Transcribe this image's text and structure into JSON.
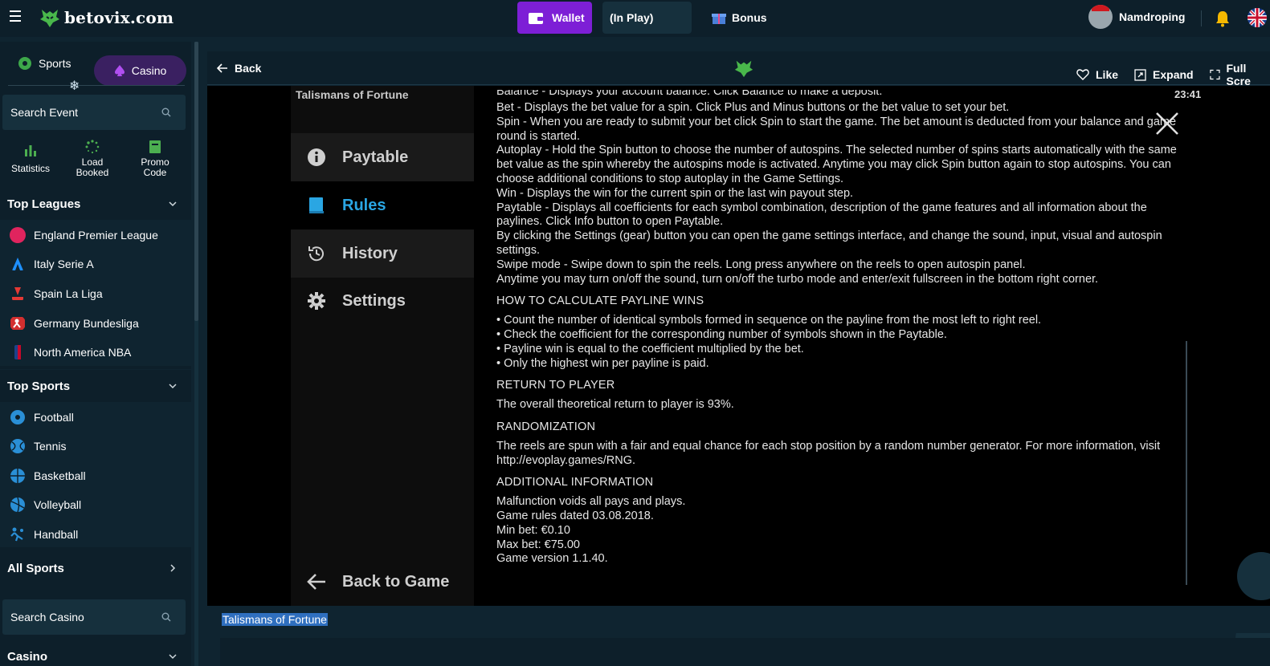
{
  "header": {
    "brand": "betovix.com",
    "wallet_label": "Wallet",
    "inplay_label": "(In Play)",
    "bonus_label": "Bonus",
    "username": "Namdroping"
  },
  "sidebar": {
    "mode_sports": "Sports",
    "mode_casino": "Casino",
    "search_event_placeholder": "Search Event",
    "quick": [
      {
        "label": "Statistics"
      },
      {
        "label": "Load Booked"
      },
      {
        "label": "Promo Code"
      }
    ],
    "top_leagues_title": "Top Leagues",
    "leagues": [
      {
        "label": "England Premier League",
        "color": "#e0245e"
      },
      {
        "label": "Italy Serie A",
        "color": "#1e90ff"
      },
      {
        "label": "Spain La Liga",
        "color": "#e53935"
      },
      {
        "label": "Germany Bundesliga",
        "color": "#d32f2f"
      },
      {
        "label": "North America NBA",
        "color": "#1d428a"
      }
    ],
    "top_sports_title": "Top Sports",
    "sports": [
      {
        "label": "Football"
      },
      {
        "label": "Tennis"
      },
      {
        "label": "Basketball"
      },
      {
        "label": "Volleyball"
      },
      {
        "label": "Handball"
      }
    ],
    "all_sports_title": "All Sports",
    "search_casino_placeholder": "Search Casino",
    "casino_title": "Casino"
  },
  "game_bar": {
    "back_label": "Back",
    "like_label": "Like",
    "expand_label": "Expand",
    "fullscreen_label": "Full Scre"
  },
  "game": {
    "title": "Talismans of Fortune",
    "clock": "23:41",
    "menu": [
      {
        "label": "Paytable"
      },
      {
        "label": "Rules"
      },
      {
        "label": "History"
      },
      {
        "label": "Settings"
      },
      {
        "label": "Back to Game"
      }
    ],
    "rules_top": [
      "Balance - Displays your account balance. Click Balance to make a deposit.",
      "Bet - Displays the bet value for a spin. Click Plus and Minus buttons or the bet value to set your bet.",
      "Spin - When you are ready to submit your bet click Spin to start the game. The bet amount is deducted from your balance and game round is started.",
      "Autoplay - Hold the Spin button to choose the number of autospins. The selected number of spins starts automatically with the same bet value as the spin whereby the autospins mode is activated. Anytime you may click Spin button again to stop autospins. You can choose additional conditions to stop autoplay in the Game Settings.",
      "Win - Displays the win for the current spin or the last win payout step.",
      "Paytable - Displays all coefficients for each symbol combination, description of the game features and all information about the paylines. Click Info button to open Paytable.",
      "By clicking the Settings (gear) button you can open the game settings interface, and change the sound, input, visual and autospin settings.",
      "Swipe mode - Swipe down to spin the reels. Long press anywhere on the reels to open autospin panel.",
      "Anytime you may turn on/off the sound, turn on/off the turbo mode and enter/exit fullscreen in the bottom right corner."
    ],
    "payline_heading": "HOW TO CALCULATE PAYLINE WINS",
    "payline_items": [
      "• Count the number of identical symbols formed in sequence on the payline from the most left to right reel.",
      "• Check the coefficient for the corresponding number of symbols shown in the Paytable.",
      "• Payline win is equal to the coefficient multiplied by the bet.",
      "• Only the highest win per payline is paid."
    ],
    "rtp_heading": "RETURN TO PLAYER",
    "rtp_text": "The overall theoretical return to player is 93%.",
    "random_heading": "RANDOMIZATION",
    "random_text": "The reels are spun with a fair and equal chance for each stop position by a random number generator. For more information, visit http://evoplay.games/RNG.",
    "additional_heading": "ADDITIONAL INFORMATION",
    "additional_items": [
      "Malfunction voids all pays and plays.",
      "Game rules dated 03.08.2018.",
      "Min bet: €0.10",
      "Max bet: €75.00",
      "Game version 1.1.40."
    ]
  },
  "info_strip": {
    "title": "Talismans of Fortune"
  },
  "colors": {
    "accent_purple": "#7d1fd6",
    "rules_active": "#2aa6e3",
    "page_bg": "#0f2430"
  }
}
